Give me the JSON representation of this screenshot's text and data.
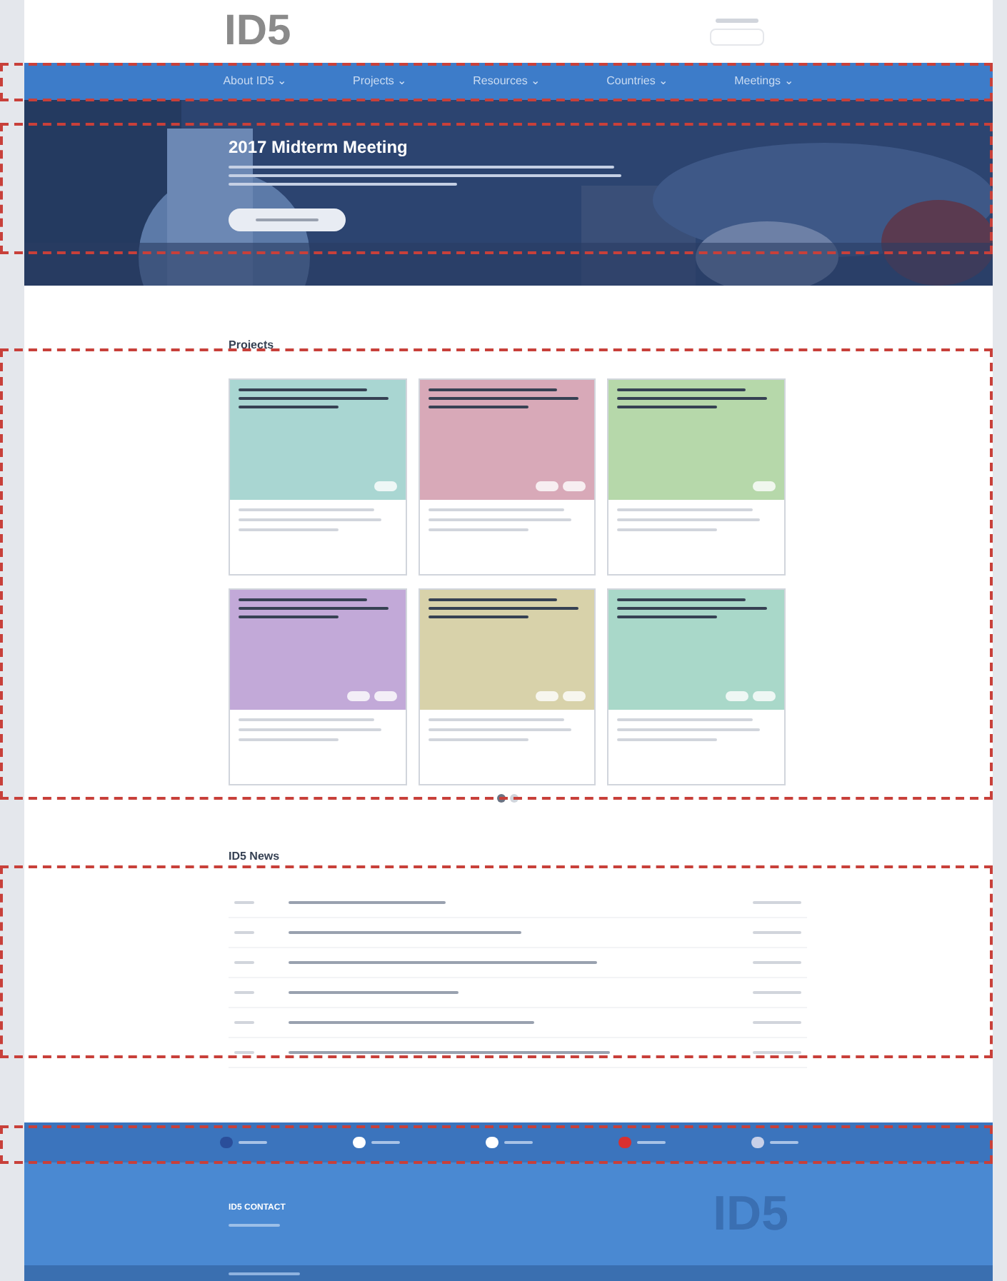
{
  "header": {
    "logo": "ID5"
  },
  "nav": [
    {
      "label": "About ID5 ⌄"
    },
    {
      "label": "Projects ⌄"
    },
    {
      "label": "Resources ⌄"
    },
    {
      "label": "Countries ⌄"
    },
    {
      "label": "Meetings ⌄"
    }
  ],
  "hero": {
    "title": "2017 Midterm Meeting"
  },
  "projects": {
    "heading": "Projects",
    "cards": [
      {
        "color": "#a9d6d2",
        "tags": [
          {
            "kind": "chip"
          }
        ]
      },
      {
        "color": "#d8a9b8",
        "tags": [
          {
            "kind": "chip"
          },
          {
            "kind": "chip"
          }
        ]
      },
      {
        "color": "#b6d8aa",
        "tags": [
          {
            "kind": "chip"
          }
        ]
      },
      {
        "color": "#c2a9d8",
        "tags": [
          {
            "kind": "chip"
          },
          {
            "kind": "chip"
          }
        ]
      },
      {
        "color": "#d8d2aa",
        "tags": [
          {
            "kind": "chip"
          },
          {
            "kind": "chip"
          }
        ]
      },
      {
        "color": "#a9d8c9",
        "tags": [
          {
            "kind": "chip"
          },
          {
            "kind": "chip"
          }
        ]
      }
    ],
    "pages": [
      {
        "selected": true
      },
      {
        "selected": false
      }
    ]
  },
  "news": {
    "heading": "ID5 News",
    "rows": [
      {
        "kind": "item"
      },
      {
        "kind": "item"
      },
      {
        "kind": "item"
      },
      {
        "kind": "item"
      },
      {
        "kind": "item"
      },
      {
        "kind": "item"
      }
    ]
  },
  "footer": {
    "contact_heading": "ID5 CONTACT",
    "logo": "ID5"
  }
}
